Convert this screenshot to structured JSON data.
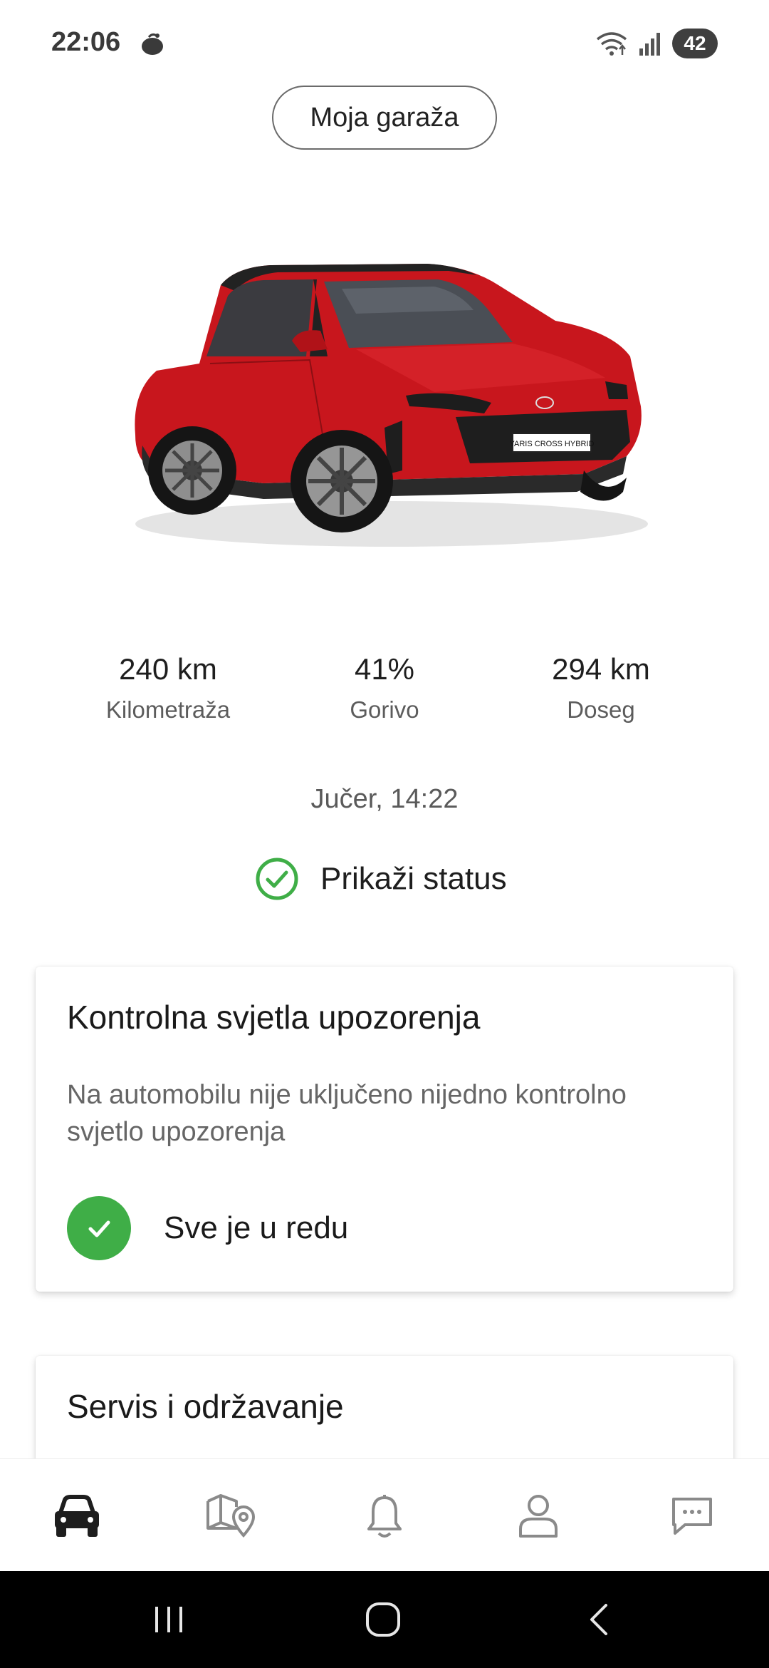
{
  "status_bar": {
    "time": "22:06",
    "battery": "42",
    "icons": [
      "app-icon",
      "wifi-icon",
      "signal-icon",
      "battery-icon"
    ]
  },
  "header": {
    "garage_button": "Moja garaža"
  },
  "vehicle": {
    "plate_text": "YARIS CROSS HYBRID",
    "body_color": "#c8161d"
  },
  "stats": [
    {
      "value": "240 km",
      "label": "Kilometraža"
    },
    {
      "value": "41%",
      "label": "Gorivo"
    },
    {
      "value": "294 km",
      "label": "Doseg"
    }
  ],
  "updated": "Jučer, 14:22",
  "status_link": {
    "label": "Prikaži status",
    "icon": "check-circle-icon"
  },
  "warning_card": {
    "title": "Kontrolna svjetla upozorenja",
    "description": "Na automobilu nije uključeno nijedno kontrolno svjetlo upozorenja",
    "ok_label": "Sve je u redu",
    "ok_color": "#3fae47"
  },
  "service_card": {
    "title": "Servis i održavanje"
  },
  "bottom_nav": {
    "items": [
      "car-icon",
      "map-pin-icon",
      "bell-icon",
      "user-icon",
      "chat-icon"
    ],
    "active": "car-icon"
  },
  "system_nav": {
    "items": [
      "recents-icon",
      "home-icon",
      "back-icon"
    ]
  },
  "colors": {
    "accent_green": "#3fae47",
    "icon_gray": "#8a8a8a",
    "icon_active": "#1e1e1e"
  }
}
